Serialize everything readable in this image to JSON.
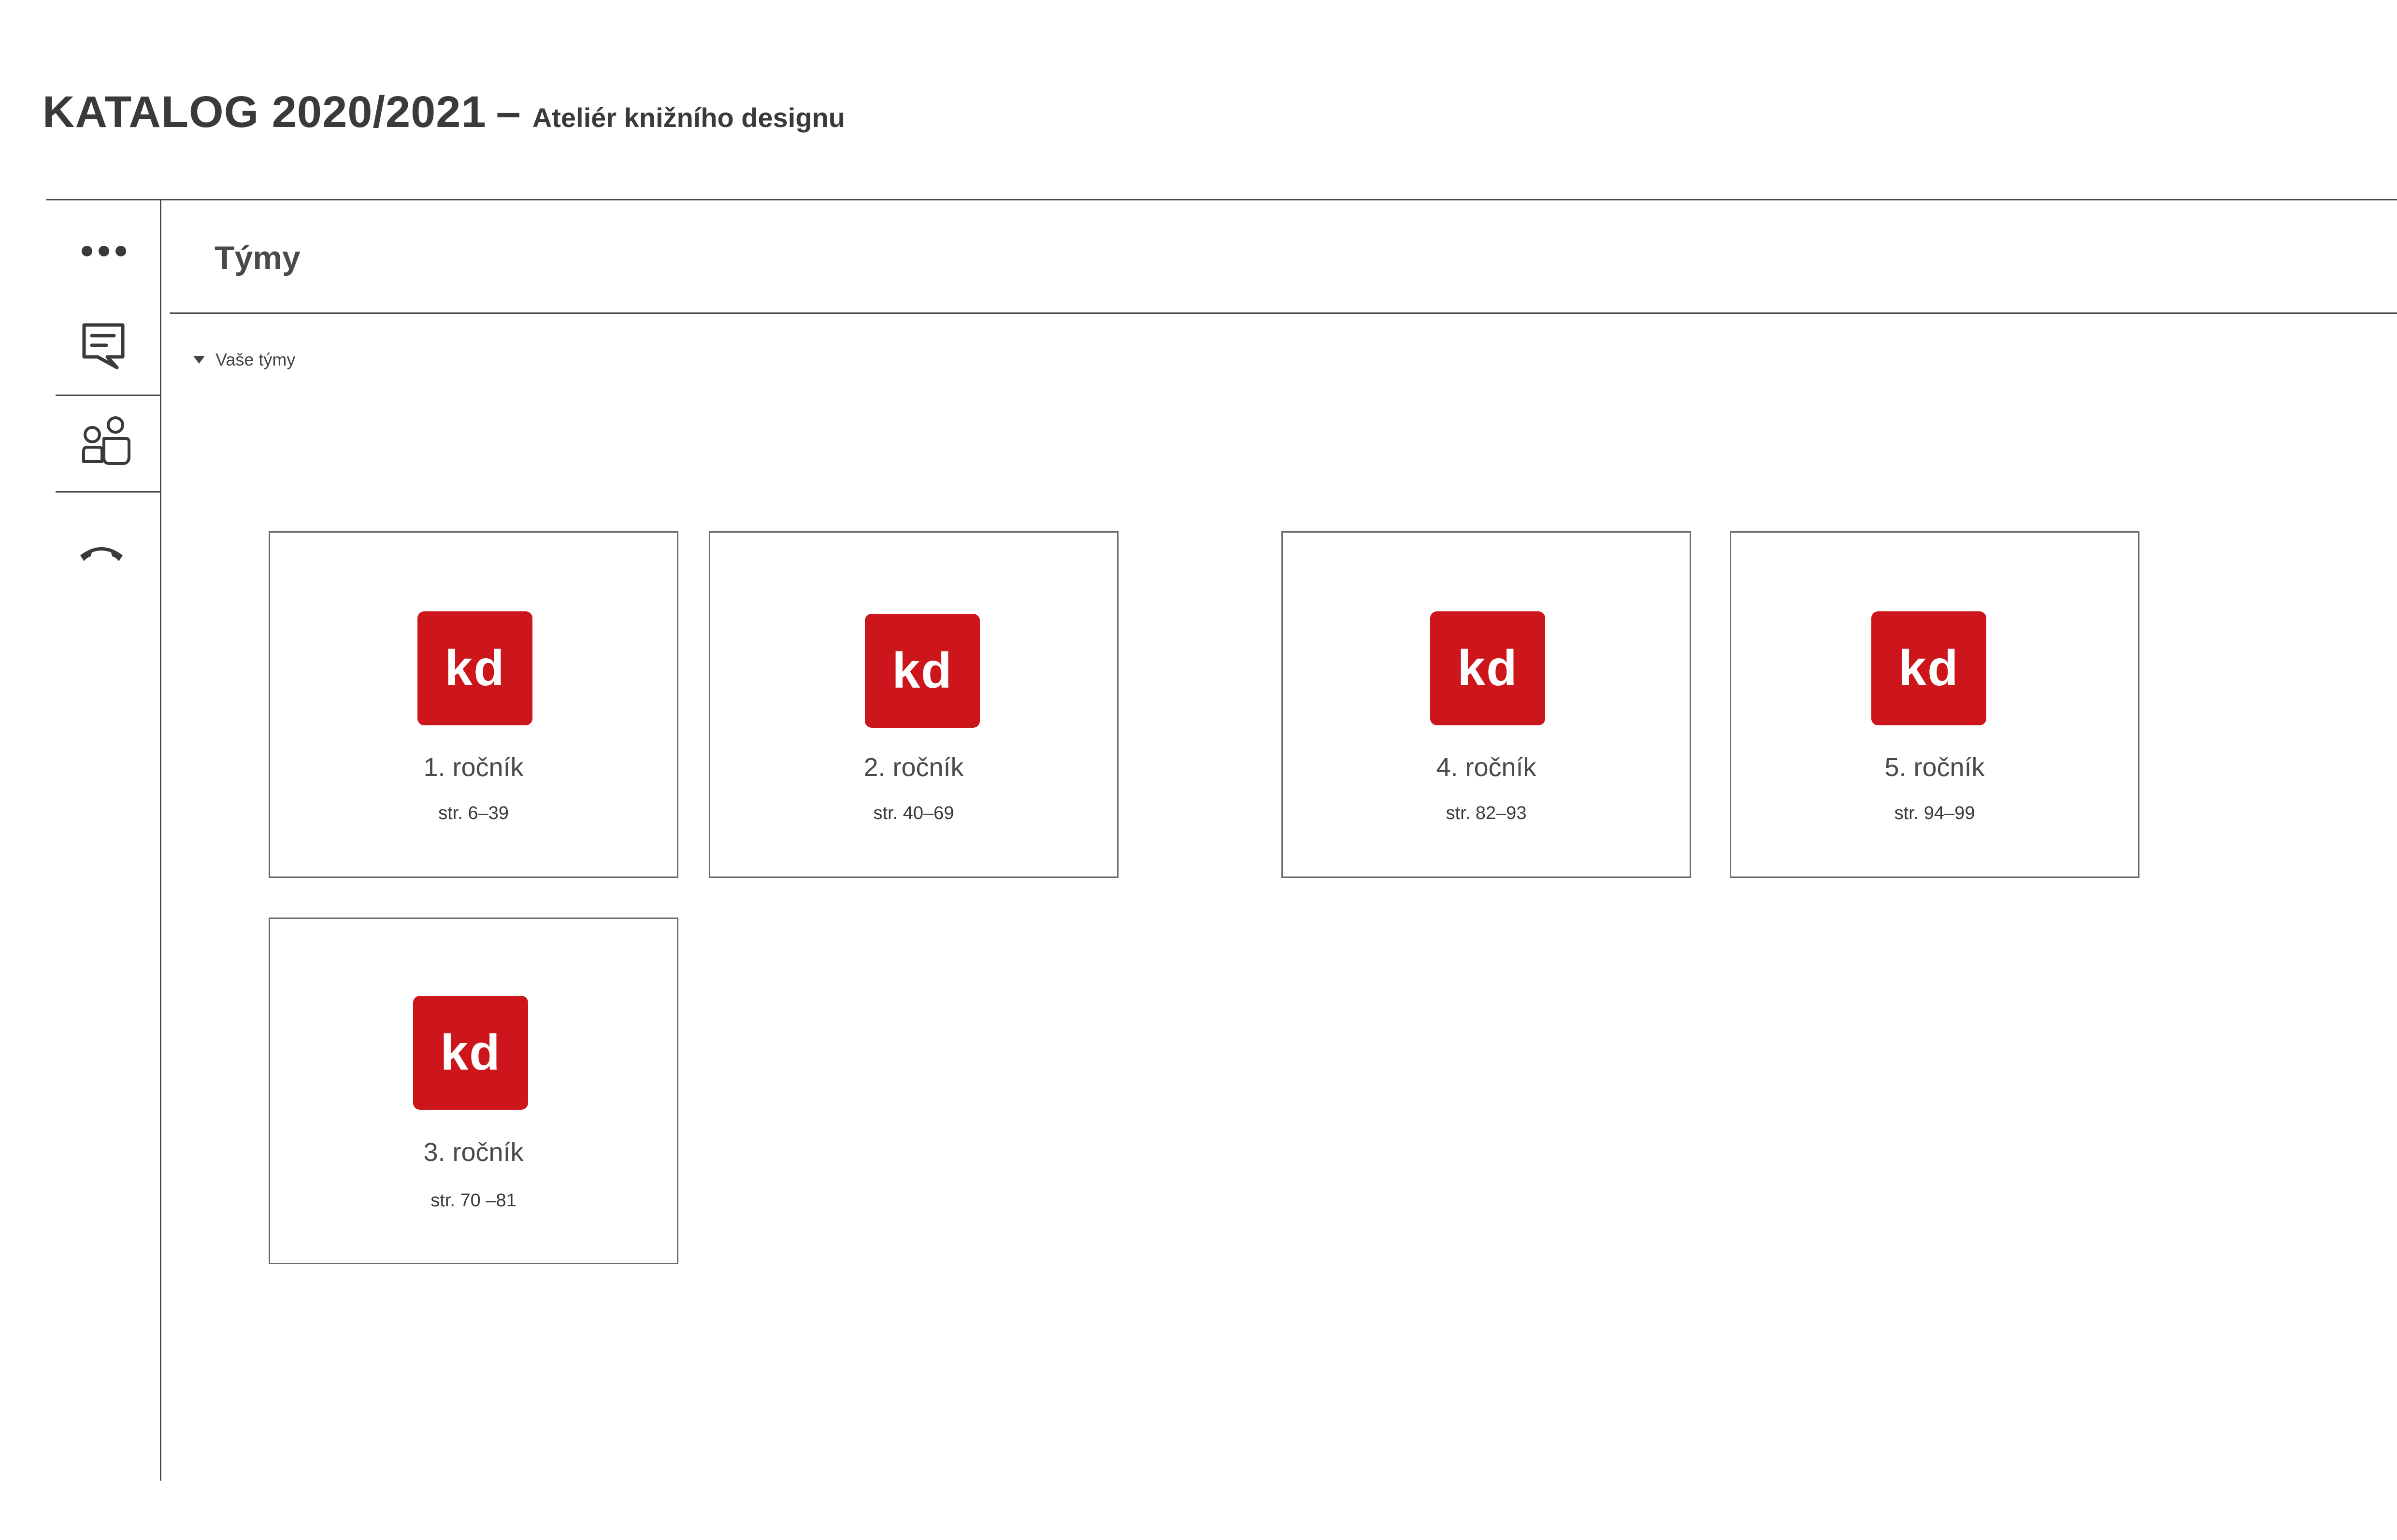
{
  "header": {
    "title": "KATALOG 2020/2021",
    "dash": "–",
    "subtitle": "Ateliér knižního designu"
  },
  "rail": {
    "items": [
      {
        "name": "more-options",
        "icon": "ellipsis-icon"
      },
      {
        "name": "chat",
        "icon": "chat-icon"
      },
      {
        "name": "teams",
        "icon": "teams-icon"
      },
      {
        "name": "calls",
        "icon": "phone-icon"
      }
    ]
  },
  "main": {
    "section_title": "Týmy",
    "group_label": "Vaše týmy"
  },
  "teams": [
    {
      "logo": "kd",
      "name": "1. ročník",
      "pages": "str. 6–39"
    },
    {
      "logo": "kd",
      "name": "2. ročník",
      "pages": "str. 40–69"
    },
    {
      "logo": "kd",
      "name": "4. ročník",
      "pages": "str. 82–93"
    },
    {
      "logo": "kd",
      "name": "5. ročník",
      "pages": "str. 94–99"
    },
    {
      "logo": "kd",
      "name": "3. ročník",
      "pages": "str. 70 –81"
    }
  ],
  "colors": {
    "logo_bg": "#cc161b",
    "logo_text": "#ffffff",
    "text": "#3a3a3a",
    "lines": "#4a4a4a"
  }
}
